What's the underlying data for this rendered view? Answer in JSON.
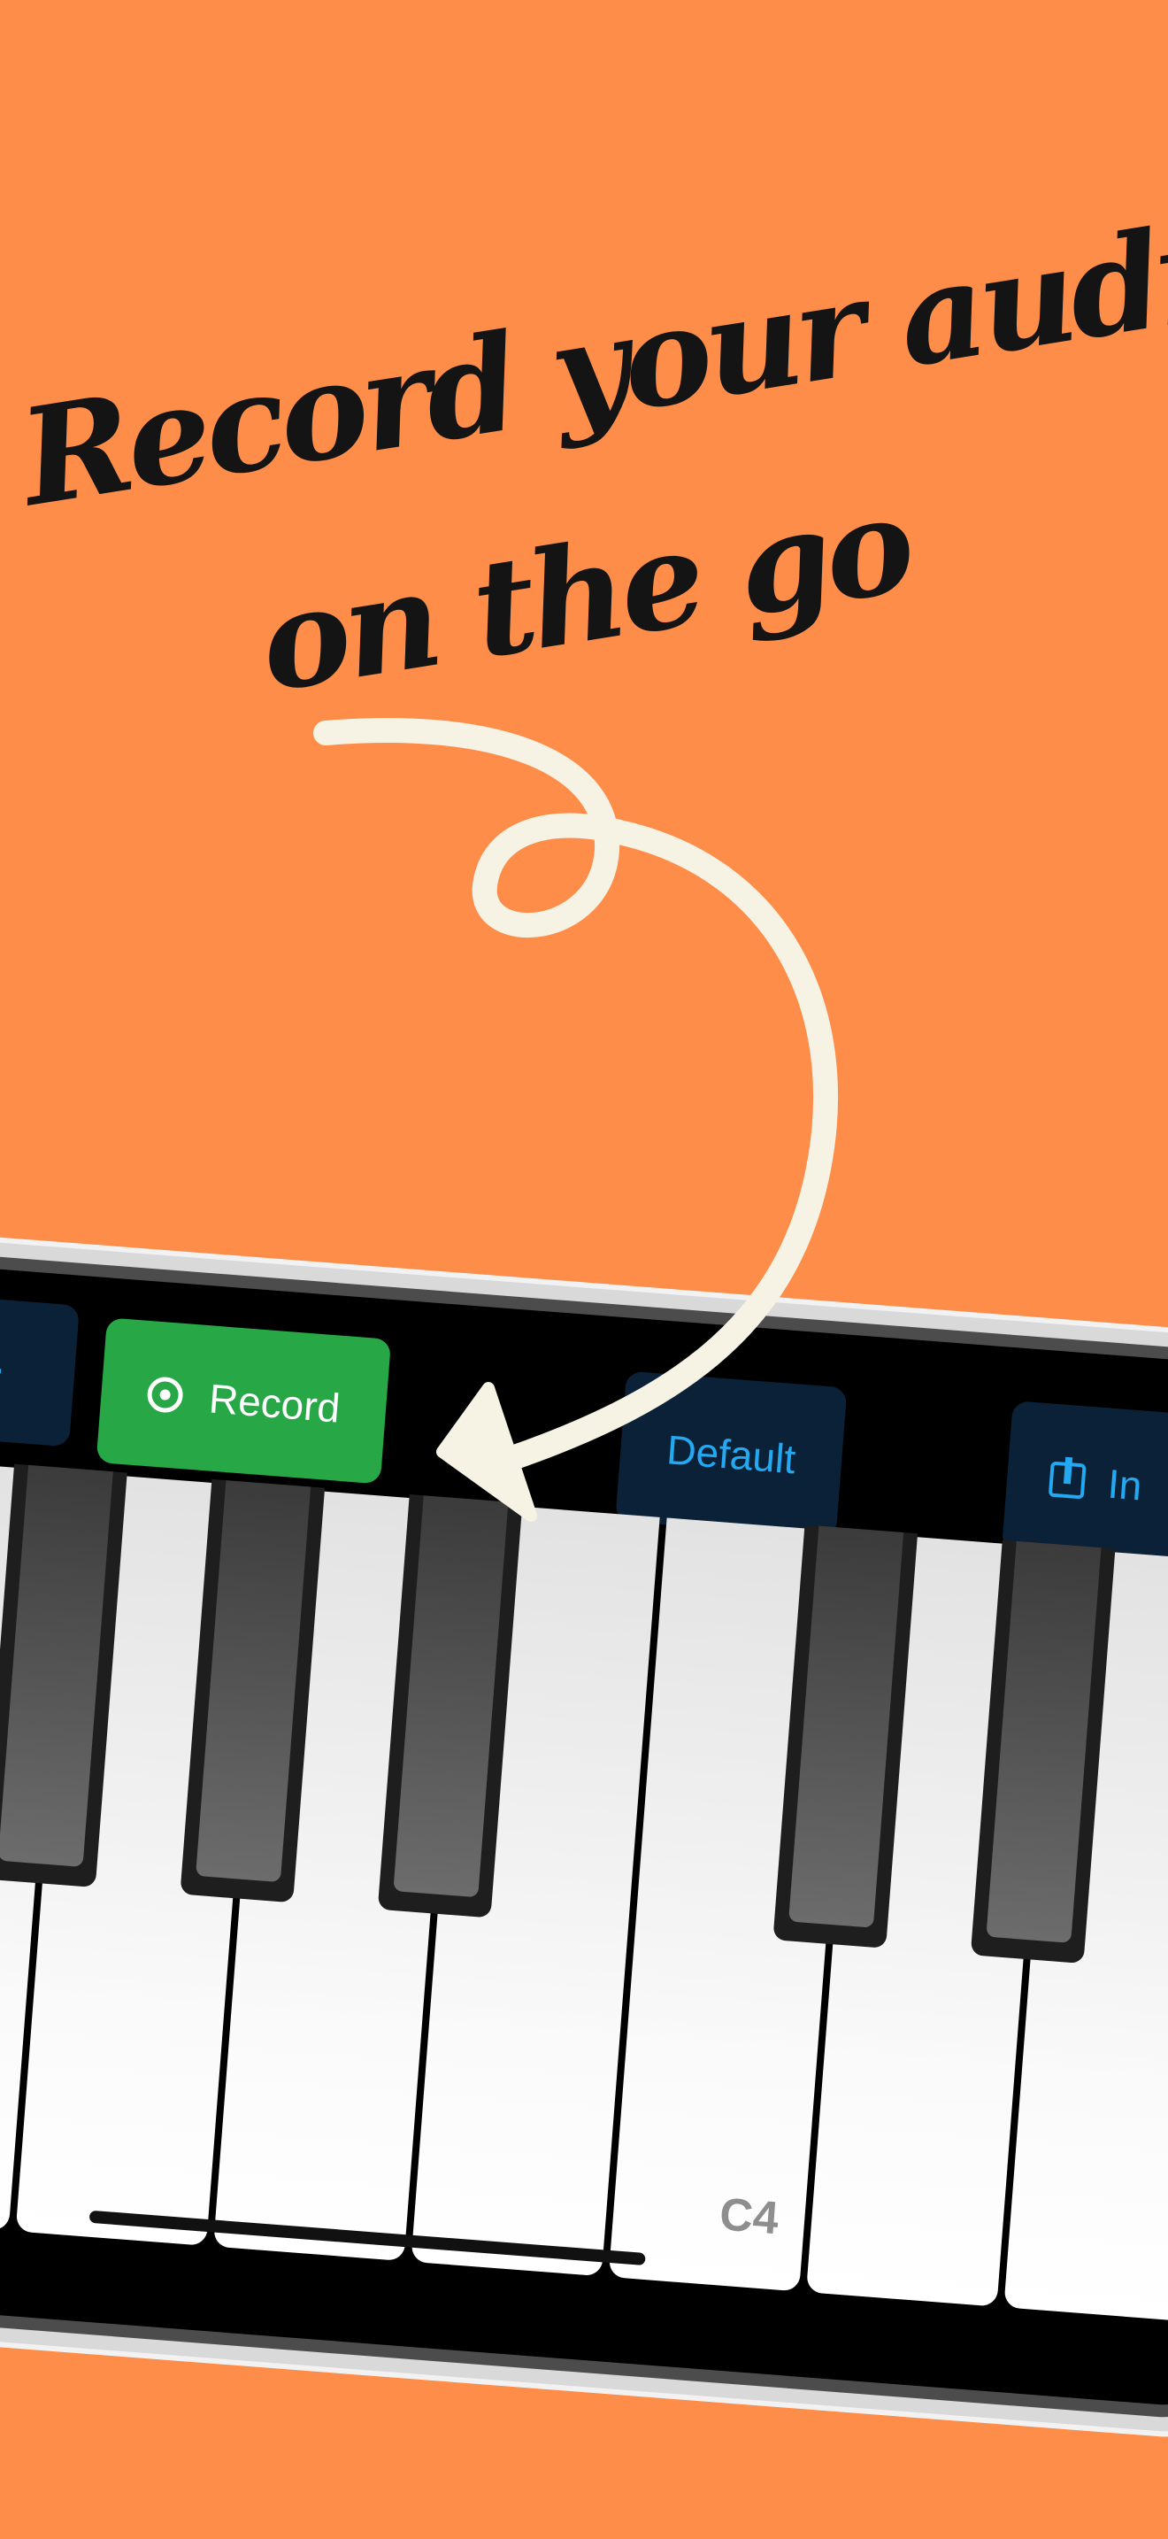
{
  "headline": {
    "line1": "Record your audio",
    "line2": "on the go"
  },
  "colors": {
    "background": "#FE8D4A",
    "record_button": "#27A746",
    "toolbar_button": "#0B2137",
    "accent_text": "#23A9F2",
    "arrow": "#F6F3E4"
  },
  "toolbar": {
    "add_label": "+",
    "record_label": "Record",
    "default_label": "Default",
    "import_label": "In"
  },
  "icons": {
    "record": "record-icon",
    "import": "import-icon"
  },
  "keyboard": {
    "key_label": "C4"
  }
}
